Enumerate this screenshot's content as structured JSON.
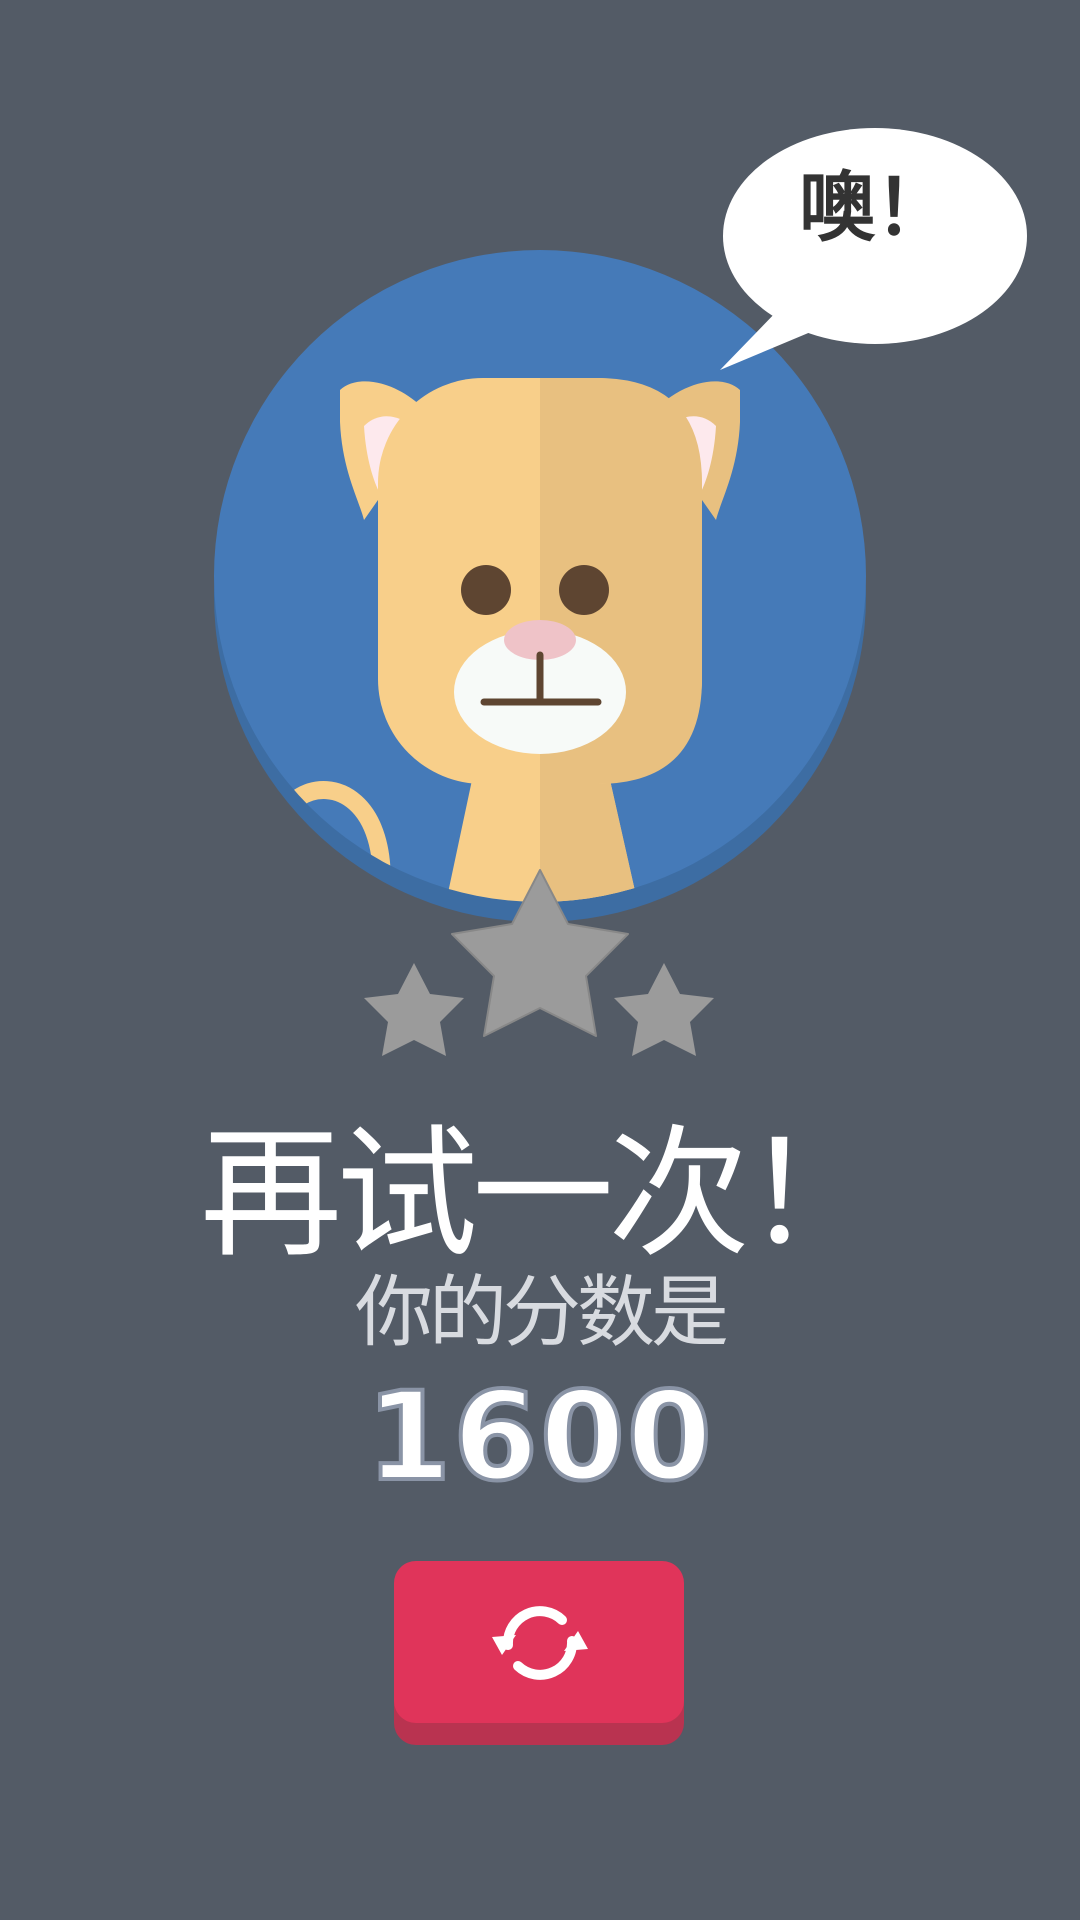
{
  "speech_bubble": {
    "text": "噢！"
  },
  "result": {
    "title": "再试一次！",
    "subtitle": "你的分数是",
    "score": "1600",
    "stars_earned": 0,
    "stars_total": 3
  },
  "buttons": {
    "retry_icon": "refresh-icon"
  },
  "colors": {
    "background": "#535b66",
    "avatar_circle": "#457ab8",
    "cat_fur": "#f8cf8a",
    "star_empty": "#9b9b9b",
    "retry_button": "#e0345a"
  }
}
